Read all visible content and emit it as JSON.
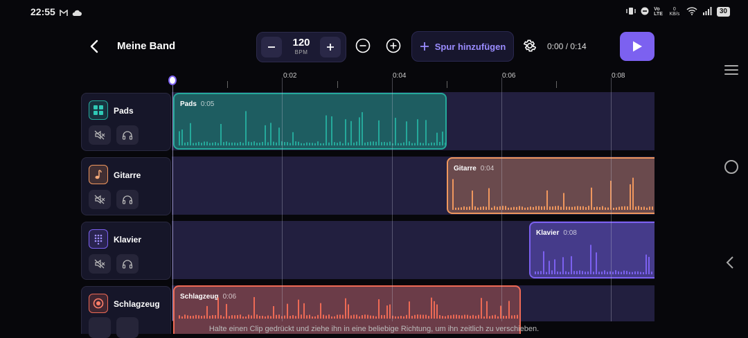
{
  "status_bar": {
    "time": "22:55",
    "battery": "30",
    "net_speed": "0 KB/s"
  },
  "header": {
    "title": "Meine Band",
    "bpm_value": "120",
    "bpm_unit": "BPM",
    "add_track_label": "Spur hinzufügen",
    "time_readout": "0:00 / 0:14"
  },
  "ruler": {
    "labels": [
      "0:02",
      "0:04",
      "0:06",
      "0:08"
    ]
  },
  "tracks": [
    {
      "name": "Pads",
      "icon": "grid-icon",
      "color": "#25a99b"
    },
    {
      "name": "Gitarre",
      "icon": "music-note-icon",
      "color": "#f0975e"
    },
    {
      "name": "Klavier",
      "icon": "keypad-icon",
      "color": "#7c61f0"
    },
    {
      "name": "Schlagzeug",
      "icon": "drum-icon",
      "color": "#ee6a55"
    }
  ],
  "clips": [
    {
      "track": "Pads",
      "label": "Pads",
      "duration": "0:05",
      "color": "#25a99b",
      "fill": "#1e5d61"
    },
    {
      "track": "Gitarre",
      "label": "Gitarre",
      "duration": "0:04",
      "color": "#f0975e",
      "fill": "#6a4a4d"
    },
    {
      "track": "Klavier",
      "label": "Klavier",
      "duration": "0:08",
      "color": "#7c61f0",
      "fill": "#453b8a"
    },
    {
      "track": "Schlagzeug",
      "label": "Schlagzeug",
      "duration": "0:06",
      "color": "#ee6a55",
      "fill": "#6b3c48"
    }
  ],
  "hint": "Halte einen Clip gedrückt und ziehe ihn in eine beliebige Richtung, um ihn zeitlich zu verschieben."
}
